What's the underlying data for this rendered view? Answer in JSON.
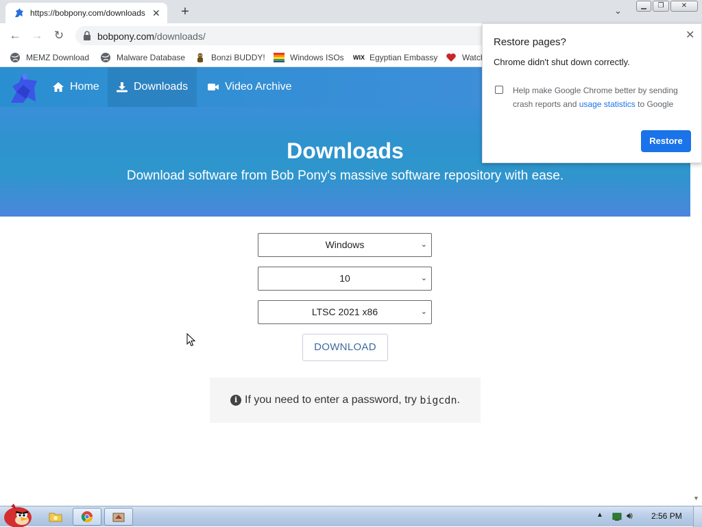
{
  "browser": {
    "tab_title": "https://bobpony.com/downloads",
    "tab_close": "✕",
    "new_tab": "+",
    "url_host": "bobpony.com",
    "url_path": "/downloads/"
  },
  "bookmarks": [
    {
      "label": "MEMZ Download",
      "icon": "globe-icon"
    },
    {
      "label": "Malware Database",
      "icon": "globe-icon"
    },
    {
      "label": "Bonzi BUDDY!",
      "icon": "bonzi-icon"
    },
    {
      "label": "Windows ISOs",
      "icon": "windows-flag-icon"
    },
    {
      "label": "Egyptian Embassy",
      "icon": "wix-icon"
    },
    {
      "label": "Watch",
      "icon": "heart-icon"
    }
  ],
  "site": {
    "nav": [
      {
        "label": "Home",
        "icon": "home-icon"
      },
      {
        "label": "Downloads",
        "icon": "download-icon"
      },
      {
        "label": "Video Archive",
        "icon": "video-icon"
      }
    ],
    "hero_title": "Downloads",
    "hero_subtitle": "Download software from Bob Pony's massive software repository with ease.",
    "selects": [
      {
        "value": "Windows"
      },
      {
        "value": "10"
      },
      {
        "value": "LTSC 2021 x86"
      }
    ],
    "download_button": "DOWNLOAD",
    "note_text": "If you need to enter a password, try",
    "note_code": "bigcdn",
    "note_end": "."
  },
  "popup": {
    "title": "Restore pages?",
    "message": "Chrome didn't shut down correctly.",
    "checkbox_text": "Help make Google Chrome better by sending crash reports and",
    "checkbox_link": "usage statistics",
    "checkbox_tail": "to Google",
    "restore_button": "Restore"
  },
  "taskbar": {
    "clock": "2:56 PM"
  },
  "colors": {
    "accent": "#1a73e8",
    "site_blue": "#2e96cc"
  }
}
